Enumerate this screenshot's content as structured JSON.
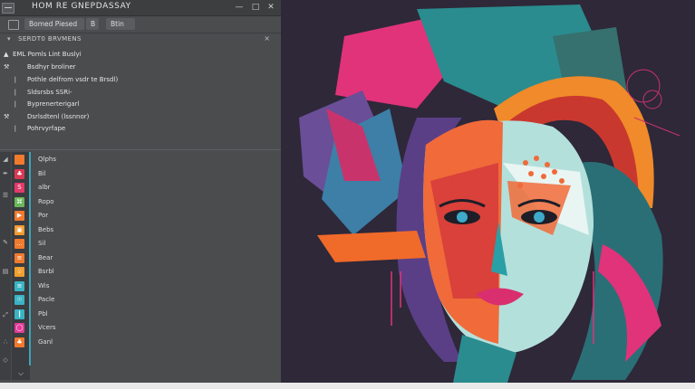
{
  "window": {
    "title": "HOM RE GNEPDASSAY",
    "buttons": [
      "—",
      "□",
      "✕"
    ]
  },
  "toolbar": {
    "field1": "Bomed  Piesed",
    "field2": "B",
    "field3": "Btin"
  },
  "section": {
    "label": "SERDT0 BRVMENS",
    "pin": "×"
  },
  "properties": [
    {
      "icon": "▲",
      "label": "EML  Pomls Lint Buslyi"
    },
    {
      "icon": "⚒",
      "label": "Bsdhyr broliner"
    },
    {
      "icon": "❘",
      "label": "Pothle delfrom vsdr te Brsdl)"
    },
    {
      "icon": "❘",
      "label": "Sldsrsbs SSRi-"
    },
    {
      "icon": "❘",
      "label": "Byprenerterigarl"
    },
    {
      "icon": "⚒",
      "label": "Dsrlsdtenl (lssnnor)"
    },
    {
      "icon": "❘",
      "label": "Pohrvyrfape"
    }
  ],
  "layers": [
    {
      "label": "Qlphs",
      "color": "#f07a2e",
      "glyph": ""
    },
    {
      "label": "Bil",
      "color": "#d93a55",
      "glyph": "♣"
    },
    {
      "label": "albr",
      "color": "#e23a6b",
      "glyph": "S"
    },
    {
      "label": "Ropo",
      "color": "#6bb85a",
      "glyph": "⌘"
    },
    {
      "label": "Por",
      "color": "#f07a2e",
      "glyph": "▶"
    },
    {
      "label": "Bebs",
      "color": "#f09a2e",
      "glyph": "▣"
    },
    {
      "label": "Sil",
      "color": "#f07a2e",
      "glyph": "…"
    },
    {
      "label": "Bear",
      "color": "#f07a2e",
      "glyph": "≡"
    },
    {
      "label": "Bsrbl",
      "color": "#f0a02e",
      "glyph": "♧"
    },
    {
      "label": "Wis",
      "color": "#39b4c4",
      "glyph": "≡"
    },
    {
      "label": "Pacle",
      "color": "#39b4c4",
      "glyph": "☉"
    },
    {
      "label": "Pbl",
      "color": "#39b4c4",
      "glyph": "❙"
    },
    {
      "label": "Vcers",
      "color": "#e23a9a",
      "glyph": "◯"
    },
    {
      "label": "Ganl",
      "color": "#f07a2e",
      "glyph": "♣"
    }
  ],
  "strip_icons": [
    "◢",
    "✒",
    "☰",
    "✎",
    "▤",
    "⤢",
    "∴",
    "◇"
  ],
  "collapse": "⌵",
  "artwork": {
    "subject": "abstract geometric portrait of a woman",
    "colors": {
      "teal": "#2e8f93",
      "orange": "#f06a2a",
      "magenta": "#e0336f",
      "purple": "#7a5aa5",
      "dark": "#2e2839"
    }
  }
}
